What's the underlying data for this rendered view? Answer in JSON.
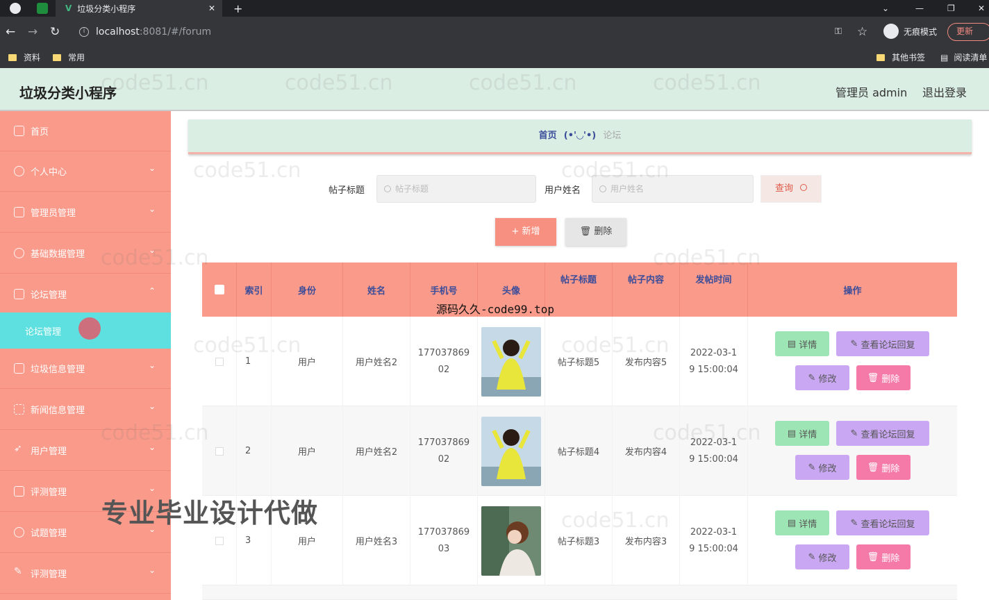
{
  "browser": {
    "tab_title": "垃圾分类小程序",
    "close": "✕",
    "new_tab": "+",
    "url_host": "localhost",
    "url_path": ":8081/#/forum",
    "bookmarks": [
      "资料",
      "常用"
    ],
    "bookmarks_right": [
      "其他书签",
      "阅读清单"
    ],
    "incognito": "无痕模式",
    "update": "更新"
  },
  "header": {
    "title": "垃圾分类小程序",
    "admin": "管理员 admin",
    "logout": "退出登录"
  },
  "sidebar": {
    "items": [
      {
        "label": "首页",
        "arrow": ""
      },
      {
        "label": "个人中心",
        "arrow": "⌄"
      },
      {
        "label": "管理员管理",
        "arrow": "⌄"
      },
      {
        "label": "基础数据管理",
        "arrow": "⌄"
      },
      {
        "label": "论坛管理",
        "arrow": "⌃"
      },
      {
        "label": "垃圾信息管理",
        "arrow": "⌄"
      },
      {
        "label": "新闻信息管理",
        "arrow": "⌄"
      },
      {
        "label": "用户管理",
        "arrow": "⌄"
      },
      {
        "label": "评测管理",
        "arrow": "⌄"
      },
      {
        "label": "试题管理",
        "arrow": "⌄"
      },
      {
        "label": "评测管理",
        "arrow": "⌄"
      }
    ],
    "active_sub": "论坛管理"
  },
  "breadcrumb": {
    "home": "首页",
    "sep": "(•'◡'•)",
    "current": "论坛"
  },
  "filters": {
    "title_label": "帖子标题",
    "title_placeholder": "帖子标题",
    "user_label": "用户姓名",
    "user_placeholder": "用户姓名",
    "query": "查询"
  },
  "actions": {
    "add": "+ 新增",
    "delete": "删除"
  },
  "table": {
    "headers": [
      "索引",
      "身份",
      "姓名",
      "手机号",
      "头像",
      "帖子标题",
      "帖子内容",
      "发帖时间",
      "操作"
    ],
    "rows": [
      {
        "index": "1",
        "role": "用户",
        "name": "用户姓名2",
        "phone1": "177037869",
        "phone2": "02",
        "title": "帖子标题5",
        "content": "发布内容5",
        "time1": "2022-03-1",
        "time2": "9 15:00:04"
      },
      {
        "index": "2",
        "role": "用户",
        "name": "用户姓名2",
        "phone1": "177037869",
        "phone2": "02",
        "title": "帖子标题4",
        "content": "发布内容4",
        "time1": "2022-03-1",
        "time2": "9 15:00:04"
      },
      {
        "index": "3",
        "role": "用户",
        "name": "用户姓名3",
        "phone1": "177037869",
        "phone2": "03",
        "title": "帖子标题3",
        "content": "发布内容3",
        "time1": "2022-03-1",
        "time2": "9 15:00:04"
      }
    ],
    "ops": {
      "detail": "详情",
      "reply": "查看论坛回复",
      "edit": "修改",
      "remove": "删除"
    }
  },
  "overlays": {
    "site": "源码久久-code99.top",
    "ad": "专业毕业设计代做",
    "watermark": "code51.cn"
  }
}
